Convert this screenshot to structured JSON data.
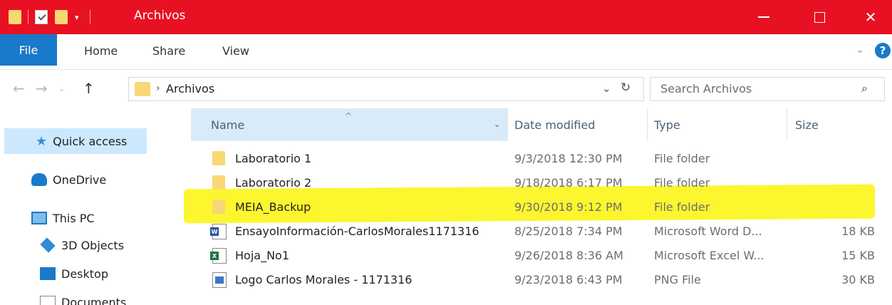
{
  "window": {
    "title": "Archivos",
    "quick_access_toolbar": [
      "folder-icon",
      "properties-check-icon",
      "new-folder-icon",
      "customize-dropdown-icon"
    ],
    "controls": [
      "minimize",
      "maximize",
      "close"
    ],
    "close_glyph": "✕",
    "accent_color": "#e81123"
  },
  "ribbon": {
    "tabs": [
      {
        "label": "File",
        "active": true
      },
      {
        "label": "Home"
      },
      {
        "label": "Share"
      },
      {
        "label": "View"
      }
    ],
    "expand_glyph": "⌄",
    "help_glyph": "?",
    "file_tab_color": "#1979ca"
  },
  "address_bar": {
    "back_glyph": "←",
    "forward_glyph": "→",
    "recent_glyph": "⌄",
    "up_glyph": "↑",
    "separator": "›",
    "path": "Archivos",
    "dropdown_glyph": "⌄",
    "refresh_glyph": "↻"
  },
  "search": {
    "placeholder": "Search Archivos",
    "icon_glyph": "⌕"
  },
  "nav_pane": {
    "items": [
      {
        "label": "Quick access",
        "icon": "star-icon",
        "selected": true
      },
      {
        "label": "OneDrive",
        "icon": "cloud-icon"
      },
      {
        "label": "This PC",
        "icon": "pc-icon"
      },
      {
        "label": "3D Objects",
        "icon": "cube-icon"
      },
      {
        "label": "Desktop",
        "icon": "desktop-icon"
      },
      {
        "label": "Documents",
        "icon": "documents-icon"
      }
    ],
    "star_glyph": "★"
  },
  "columns": {
    "name": "Name",
    "date": "Date modified",
    "type": "Type",
    "size": "Size",
    "sort_glyph": "^",
    "name_menu_glyph": "⌄"
  },
  "files": [
    {
      "name": "Laboratorio 1",
      "date": "9/3/2018 12:30 PM",
      "type": "File folder",
      "size": "",
      "icon": "folder-icon"
    },
    {
      "name": "Laboratorio 2",
      "date": "9/18/2018 6:17 PM",
      "type": "File folder",
      "size": "",
      "icon": "folder-icon"
    },
    {
      "name": "MEIA_Backup",
      "date": "9/30/2018 9:12 PM",
      "type": "File folder",
      "size": "",
      "icon": "folder-icon",
      "highlighted": true
    },
    {
      "name": "EnsayoInformación-CarlosMorales1171316",
      "date": "8/25/2018 7:34 PM",
      "type": "Microsoft Word D...",
      "size": "18 KB",
      "icon": "word-doc-icon",
      "badge": "W"
    },
    {
      "name": "Hoja_No1",
      "date": "9/26/2018 8:36 AM",
      "type": "Microsoft Excel W...",
      "size": "15 KB",
      "icon": "excel-doc-icon",
      "badge": "X"
    },
    {
      "name": "Logo Carlos Morales - 1171316",
      "date": "9/23/2018 6:43 PM",
      "type": "PNG File",
      "size": "30 KB",
      "icon": "png-image-icon"
    }
  ],
  "highlight_color": "#fbf40a"
}
